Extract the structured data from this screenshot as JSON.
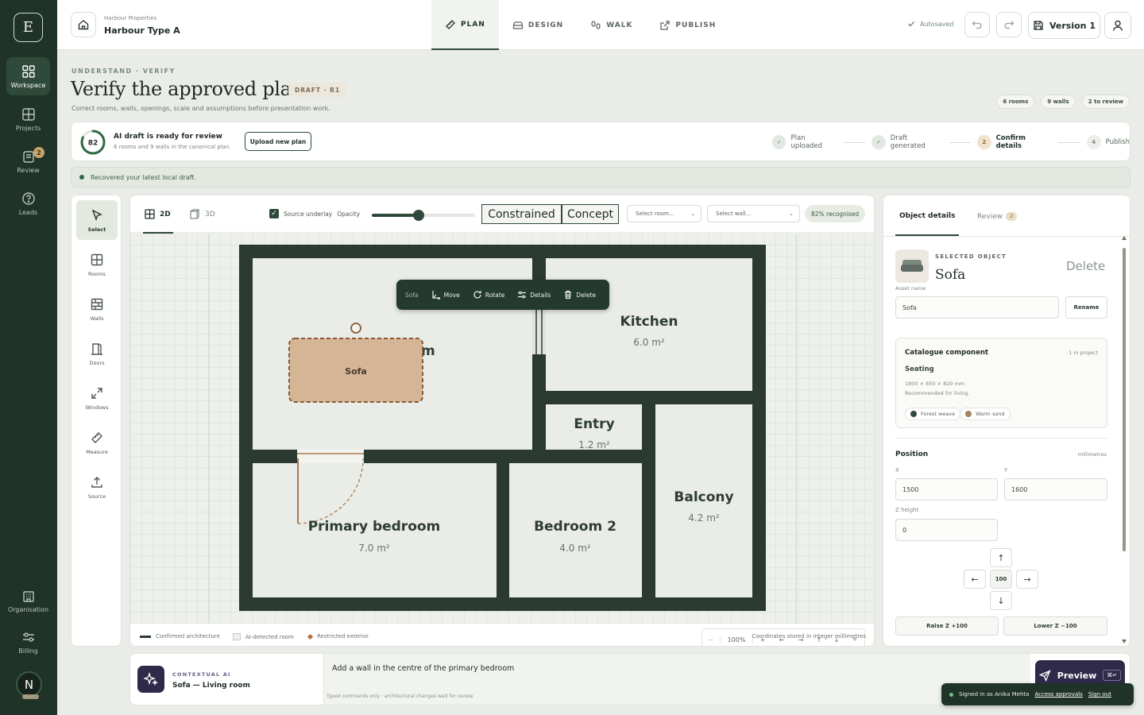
{
  "app": {
    "logo_letter": "E",
    "user_initial": "N"
  },
  "rail": {
    "items": [
      {
        "label": "Workspace",
        "icon": "grid-icon"
      },
      {
        "label": "Projects",
        "icon": "projects-icon"
      },
      {
        "label": "Review",
        "icon": "review-icon",
        "badge": "2"
      },
      {
        "label": "Leads",
        "icon": "help-circle-icon"
      },
      {
        "label": "Organisation",
        "icon": "building-icon"
      },
      {
        "label": "Billing",
        "icon": "sliders-icon"
      }
    ]
  },
  "header": {
    "project_owner": "Harbour Properties",
    "project_name": "Harbour Type A",
    "tabs": [
      {
        "label": "PLAN",
        "active": true
      },
      {
        "label": "DESIGN",
        "active": false
      },
      {
        "label": "WALK",
        "active": false
      },
      {
        "label": "PUBLISH",
        "active": false
      }
    ],
    "autosaved": "Autosaved",
    "version": "Version 1"
  },
  "page": {
    "eyebrow": "UNDERSTAND · VERIFY",
    "title": "Verify the approved plan",
    "draft_badge": "DRAFT · R1",
    "subtitle": "Correct rooms, walls, openings, scale and assumptions before presentation work.",
    "chips": [
      "6 rooms",
      "9 walls",
      "2 to review"
    ]
  },
  "status": {
    "score": "82",
    "score_fraction": 0.82,
    "title": "AI draft is ready for review",
    "sub": "6 rooms and 9 walls in the canonical plan.",
    "upload_label": "Upload new plan",
    "steps": [
      {
        "label": "Plan uploaded",
        "state": "done",
        "mark": "✓"
      },
      {
        "label": "Draft generated",
        "state": "done",
        "mark": "✓"
      },
      {
        "label": "Confirm details",
        "state": "current",
        "mark": "2"
      },
      {
        "label": "Publish",
        "state": "todo",
        "mark": "4"
      }
    ]
  },
  "notice": "Recovered your latest local draft.",
  "tools": [
    {
      "label": "Select",
      "icon": "cursor-icon",
      "active": true
    },
    {
      "label": "Rooms",
      "icon": "rooms-icon"
    },
    {
      "label": "Walls",
      "icon": "walls-icon"
    },
    {
      "label": "Doors",
      "icon": "door-icon"
    },
    {
      "label": "Windows",
      "icon": "expand-icon"
    },
    {
      "label": "Measure",
      "icon": "ruler-icon"
    },
    {
      "label": "Source",
      "icon": "upload-icon"
    }
  ],
  "canvas": {
    "view_2d": "2D",
    "view_3d": "3D",
    "underlay_label": "Source underlay",
    "opacity_label": "Opacity",
    "opacity_value": 0.45,
    "mode_constrained": "Constrained",
    "mode_concept": "Concept",
    "select_room": "Select room...",
    "select_wall": "Select wall...",
    "recognised": "82% recognised",
    "context_menu": {
      "item": "Sofa",
      "move": "Move",
      "rotate": "Rotate",
      "details": "Details",
      "delete": "Delete"
    },
    "rooms": [
      {
        "name": "Kitchen",
        "area": "6.0 m²"
      },
      {
        "name": "Entry",
        "area": "1.2 m²"
      },
      {
        "name": "Balcony",
        "area": "4.2 m²"
      },
      {
        "name": "Primary bedroom",
        "area": "7.0 m²"
      },
      {
        "name": "Bedroom 2",
        "area": "4.0 m²"
      }
    ],
    "living_room_label_fragment": "m",
    "furniture_label": "Sofa",
    "zoom": "100%",
    "legend": {
      "confirmed": "Confirmed architecture",
      "ai_detected": "AI-detected room",
      "restricted": "Restricted exterior",
      "coords": "Coordinates stored in integer millimetres"
    }
  },
  "details": {
    "tab_object": "Object details",
    "tab_review": "Review",
    "review_count": "2",
    "eyebrow": "SELECTED OBJECT",
    "name": "Sofa",
    "delete": "Delete",
    "asset_label": "Asset name",
    "asset_value": "Sofa",
    "rename": "Rename",
    "catalog": {
      "title": "Catalogue component",
      "count": "1 in project",
      "category": "Seating",
      "dims": "1800 × 850 × 820 mm",
      "note": "Recommended for living.",
      "swatches": [
        {
          "name": "Forest weave",
          "color": "#2f4a3b"
        },
        {
          "name": "Warm sand",
          "color": "#a48560"
        }
      ]
    },
    "position_label": "Position",
    "units": "millimetres",
    "x_label": "X",
    "x_value": "1500",
    "y_label": "Y",
    "y_value": "1600",
    "z_label": "Z height",
    "z_value": "0",
    "step_value": "100",
    "raise": "Raise Z +100",
    "lower": "Lower Z −100"
  },
  "ai": {
    "label": "CONTEXTUAL AI",
    "context": "Sofa — Living room",
    "command": "Add a wall in the centre of the primary bedroom",
    "hint": "Typed commands only · architectural changes wait for review",
    "preview": "Preview",
    "shortcut": "⌘↵"
  },
  "toast": {
    "signed_in": "Signed in as Anika Mehta",
    "approvals": "Access approvals",
    "signout": "Sign out"
  },
  "colors": {
    "brand": "#1f3328",
    "accent": "#2f4a3b",
    "furniture": "#d4b596",
    "ai": "#2f2a4a"
  }
}
